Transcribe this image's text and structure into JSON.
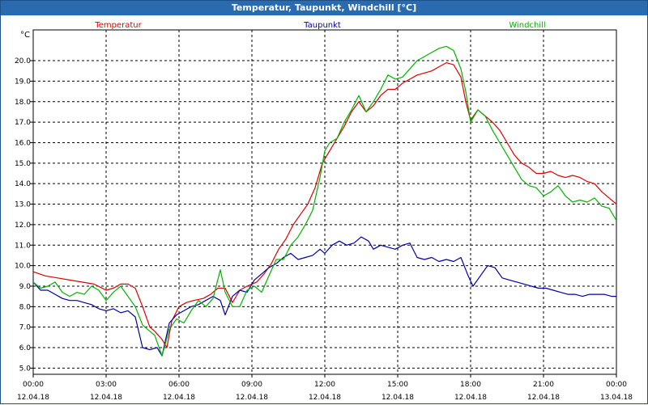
{
  "window": {
    "title": "Temperatur, Taupunkt, Windchill [°C]"
  },
  "chart_data": {
    "type": "line",
    "title": "Temperatur, Taupunkt, Windchill [°C]",
    "ylabel": "°C",
    "ylim": [
      4.7,
      21.5
    ],
    "yticks": [
      "5.0",
      "6.0",
      "7.0",
      "8.0",
      "9.0",
      "10.0",
      "11.0",
      "12.0",
      "13.0",
      "14.0",
      "15.0",
      "16.0",
      "17.0",
      "18.0",
      "19.0",
      "20.0"
    ],
    "xlim": [
      0,
      24
    ],
    "xticks": [
      {
        "time": "00:00",
        "date": "12.04.18"
      },
      {
        "time": "03:00",
        "date": "12.04.18"
      },
      {
        "time": "06:00",
        "date": "12.04.18"
      },
      {
        "time": "09:00",
        "date": "12.04.18"
      },
      {
        "time": "12:00",
        "date": "12.04.18"
      },
      {
        "time": "15:00",
        "date": "12.04.18"
      },
      {
        "time": "18:00",
        "date": "12.04.18"
      },
      {
        "time": "21:00",
        "date": "12.04.18"
      },
      {
        "time": "00:00",
        "date": "13.04.18"
      }
    ],
    "grid": true,
    "series": [
      {
        "name": "Temperatur",
        "color": "#e00000",
        "points": [
          [
            0.0,
            9.7
          ],
          [
            0.5,
            9.5
          ],
          [
            1.0,
            9.4
          ],
          [
            1.5,
            9.3
          ],
          [
            2.0,
            9.2
          ],
          [
            2.5,
            9.1
          ],
          [
            3.0,
            8.8
          ],
          [
            3.3,
            8.9
          ],
          [
            3.6,
            9.1
          ],
          [
            3.9,
            9.1
          ],
          [
            4.2,
            8.9
          ],
          [
            4.5,
            8.0
          ],
          [
            4.8,
            7.0
          ],
          [
            5.0,
            6.8
          ],
          [
            5.3,
            6.4
          ],
          [
            5.5,
            6.0
          ],
          [
            5.7,
            7.3
          ],
          [
            6.0,
            8.0
          ],
          [
            6.3,
            8.2
          ],
          [
            6.6,
            8.3
          ],
          [
            7.0,
            8.4
          ],
          [
            7.3,
            8.6
          ],
          [
            7.6,
            8.9
          ],
          [
            7.9,
            8.9
          ],
          [
            8.2,
            8.2
          ],
          [
            8.5,
            8.8
          ],
          [
            8.8,
            9.0
          ],
          [
            9.2,
            9.2
          ],
          [
            9.5,
            9.6
          ],
          [
            9.8,
            10.1
          ],
          [
            10.1,
            10.8
          ],
          [
            10.4,
            11.3
          ],
          [
            10.7,
            12.0
          ],
          [
            11.0,
            12.5
          ],
          [
            11.3,
            13.0
          ],
          [
            11.6,
            13.8
          ],
          [
            11.9,
            15.0
          ],
          [
            12.2,
            15.6
          ],
          [
            12.5,
            16.2
          ],
          [
            12.8,
            16.8
          ],
          [
            13.1,
            17.5
          ],
          [
            13.4,
            18.0
          ],
          [
            13.7,
            17.5
          ],
          [
            14.0,
            17.8
          ],
          [
            14.3,
            18.3
          ],
          [
            14.6,
            18.6
          ],
          [
            14.9,
            18.6
          ],
          [
            15.2,
            18.9
          ],
          [
            15.5,
            19.1
          ],
          [
            15.8,
            19.3
          ],
          [
            16.1,
            19.4
          ],
          [
            16.4,
            19.5
          ],
          [
            16.7,
            19.7
          ],
          [
            17.0,
            19.9
          ],
          [
            17.3,
            19.8
          ],
          [
            17.6,
            19.2
          ],
          [
            17.8,
            18.0
          ],
          [
            18.0,
            17.1
          ],
          [
            18.3,
            17.6
          ],
          [
            18.6,
            17.3
          ],
          [
            18.9,
            17.0
          ],
          [
            19.2,
            16.6
          ],
          [
            19.5,
            16.0
          ],
          [
            19.8,
            15.4
          ],
          [
            20.1,
            15.0
          ],
          [
            20.4,
            14.8
          ],
          [
            20.7,
            14.5
          ],
          [
            21.0,
            14.5
          ],
          [
            21.3,
            14.6
          ],
          [
            21.6,
            14.4
          ],
          [
            21.9,
            14.3
          ],
          [
            22.2,
            14.4
          ],
          [
            22.5,
            14.3
          ],
          [
            22.8,
            14.1
          ],
          [
            23.1,
            14.0
          ],
          [
            23.4,
            13.6
          ],
          [
            23.7,
            13.3
          ],
          [
            24.0,
            13.0
          ]
        ]
      },
      {
        "name": "Taupunkt",
        "color": "#0000a8",
        "points": [
          [
            0.0,
            9.2
          ],
          [
            0.3,
            8.8
          ],
          [
            0.6,
            8.8
          ],
          [
            0.9,
            8.6
          ],
          [
            1.2,
            8.4
          ],
          [
            1.5,
            8.3
          ],
          [
            1.8,
            8.3
          ],
          [
            2.1,
            8.2
          ],
          [
            2.4,
            8.1
          ],
          [
            2.7,
            7.9
          ],
          [
            3.0,
            7.8
          ],
          [
            3.3,
            7.9
          ],
          [
            3.6,
            7.7
          ],
          [
            3.9,
            7.8
          ],
          [
            4.2,
            7.5
          ],
          [
            4.5,
            6.0
          ],
          [
            4.8,
            5.9
          ],
          [
            5.1,
            6.0
          ],
          [
            5.3,
            5.6
          ],
          [
            5.6,
            7.2
          ],
          [
            5.9,
            7.6
          ],
          [
            6.2,
            7.8
          ],
          [
            6.5,
            8.0
          ],
          [
            6.8,
            8.1
          ],
          [
            7.1,
            8.3
          ],
          [
            7.4,
            8.5
          ],
          [
            7.7,
            8.3
          ],
          [
            7.9,
            7.6
          ],
          [
            8.2,
            8.5
          ],
          [
            8.5,
            8.8
          ],
          [
            8.8,
            8.7
          ],
          [
            9.1,
            9.3
          ],
          [
            9.4,
            9.6
          ],
          [
            9.7,
            9.9
          ],
          [
            10.0,
            10.1
          ],
          [
            10.3,
            10.4
          ],
          [
            10.6,
            10.6
          ],
          [
            10.9,
            10.3
          ],
          [
            11.2,
            10.4
          ],
          [
            11.5,
            10.5
          ],
          [
            11.8,
            10.8
          ],
          [
            12.0,
            10.6
          ],
          [
            12.3,
            11.0
          ],
          [
            12.6,
            11.2
          ],
          [
            12.9,
            11.0
          ],
          [
            13.2,
            11.1
          ],
          [
            13.5,
            11.4
          ],
          [
            13.8,
            11.2
          ],
          [
            14.0,
            10.8
          ],
          [
            14.3,
            11.0
          ],
          [
            14.6,
            10.9
          ],
          [
            14.9,
            10.8
          ],
          [
            15.2,
            11.0
          ],
          [
            15.5,
            11.1
          ],
          [
            15.8,
            10.4
          ],
          [
            16.1,
            10.3
          ],
          [
            16.4,
            10.4
          ],
          [
            16.7,
            10.2
          ],
          [
            17.0,
            10.3
          ],
          [
            17.3,
            10.2
          ],
          [
            17.6,
            10.4
          ],
          [
            17.9,
            9.5
          ],
          [
            18.1,
            9.0
          ],
          [
            18.4,
            9.5
          ],
          [
            18.7,
            10.0
          ],
          [
            19.0,
            9.9
          ],
          [
            19.3,
            9.4
          ],
          [
            19.6,
            9.3
          ],
          [
            19.9,
            9.2
          ],
          [
            20.2,
            9.1
          ],
          [
            20.5,
            9.0
          ],
          [
            20.8,
            8.9
          ],
          [
            21.1,
            8.9
          ],
          [
            21.4,
            8.8
          ],
          [
            21.7,
            8.7
          ],
          [
            22.0,
            8.6
          ],
          [
            22.3,
            8.6
          ],
          [
            22.6,
            8.5
          ],
          [
            22.9,
            8.6
          ],
          [
            23.2,
            8.6
          ],
          [
            23.5,
            8.6
          ],
          [
            23.8,
            8.5
          ],
          [
            24.0,
            8.5
          ]
        ]
      },
      {
        "name": "Windchill",
        "color": "#00b400",
        "points": [
          [
            0.0,
            9.2
          ],
          [
            0.3,
            8.9
          ],
          [
            0.6,
            9.0
          ],
          [
            0.9,
            9.2
          ],
          [
            1.2,
            8.7
          ],
          [
            1.5,
            8.5
          ],
          [
            1.8,
            8.7
          ],
          [
            2.1,
            8.6
          ],
          [
            2.4,
            9.0
          ],
          [
            2.7,
            8.8
          ],
          [
            3.0,
            8.3
          ],
          [
            3.3,
            8.7
          ],
          [
            3.6,
            9.0
          ],
          [
            3.9,
            8.5
          ],
          [
            4.2,
            8.0
          ],
          [
            4.5,
            7.1
          ],
          [
            4.8,
            6.8
          ],
          [
            5.0,
            6.6
          ],
          [
            5.3,
            5.6
          ],
          [
            5.6,
            6.9
          ],
          [
            5.9,
            7.4
          ],
          [
            6.2,
            7.2
          ],
          [
            6.5,
            7.8
          ],
          [
            6.8,
            8.3
          ],
          [
            7.1,
            8.0
          ],
          [
            7.4,
            8.4
          ],
          [
            7.7,
            9.8
          ],
          [
            7.9,
            8.7
          ],
          [
            8.2,
            8.0
          ],
          [
            8.5,
            8.0
          ],
          [
            8.8,
            8.8
          ],
          [
            9.1,
            9.0
          ],
          [
            9.4,
            8.7
          ],
          [
            9.7,
            9.5
          ],
          [
            10.0,
            10.3
          ],
          [
            10.3,
            10.3
          ],
          [
            10.6,
            11.0
          ],
          [
            10.9,
            11.4
          ],
          [
            11.2,
            12.0
          ],
          [
            11.5,
            12.7
          ],
          [
            11.8,
            14.3
          ],
          [
            12.0,
            15.6
          ],
          [
            12.2,
            16.0
          ],
          [
            12.5,
            16.2
          ],
          [
            12.8,
            17.0
          ],
          [
            13.1,
            17.6
          ],
          [
            13.4,
            18.3
          ],
          [
            13.7,
            17.5
          ],
          [
            14.0,
            18.0
          ],
          [
            14.3,
            18.6
          ],
          [
            14.6,
            19.3
          ],
          [
            14.9,
            19.1
          ],
          [
            15.2,
            19.2
          ],
          [
            15.5,
            19.6
          ],
          [
            15.8,
            20.0
          ],
          [
            16.1,
            20.2
          ],
          [
            16.4,
            20.4
          ],
          [
            16.7,
            20.6
          ],
          [
            17.0,
            20.7
          ],
          [
            17.3,
            20.5
          ],
          [
            17.6,
            19.6
          ],
          [
            17.8,
            18.5
          ],
          [
            18.0,
            17.0
          ],
          [
            18.3,
            17.6
          ],
          [
            18.6,
            17.3
          ],
          [
            18.9,
            16.6
          ],
          [
            19.2,
            16.0
          ],
          [
            19.5,
            15.4
          ],
          [
            19.8,
            14.8
          ],
          [
            20.1,
            14.2
          ],
          [
            20.4,
            13.9
          ],
          [
            20.7,
            13.8
          ],
          [
            21.0,
            13.4
          ],
          [
            21.3,
            13.6
          ],
          [
            21.6,
            13.9
          ],
          [
            21.9,
            13.4
          ],
          [
            22.2,
            13.1
          ],
          [
            22.5,
            13.2
          ],
          [
            22.8,
            13.1
          ],
          [
            23.1,
            13.3
          ],
          [
            23.4,
            12.9
          ],
          [
            23.7,
            12.8
          ],
          [
            24.0,
            12.2
          ]
        ]
      }
    ]
  }
}
